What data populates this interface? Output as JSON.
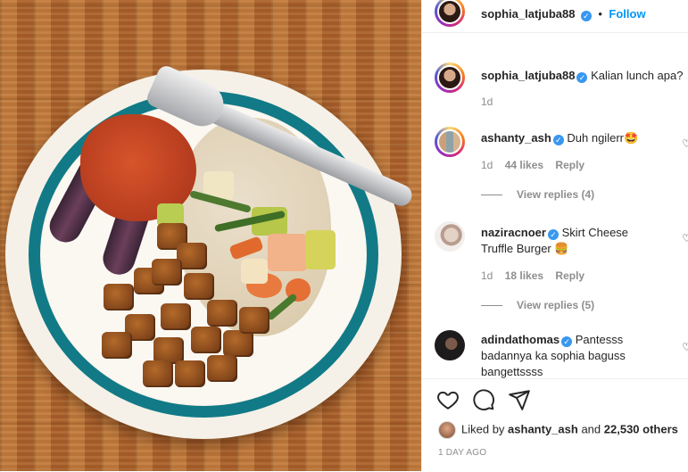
{
  "post": {
    "author": "sophia_latjuba88",
    "follow_label": "Follow",
    "dot": "•",
    "caption": "Kalian lunch apa?",
    "caption_time": "1d"
  },
  "comments": [
    {
      "user": "ashanty_ash",
      "text": "Duh ngilerr🤩",
      "time": "1d",
      "likes": "44 likes",
      "reply_label": "Reply",
      "view_replies": "View replies (4)"
    },
    {
      "user": "naziracnoer",
      "text": "Skirt Cheese Truffle Burger 🍔",
      "time": "1d",
      "likes": "18 likes",
      "reply_label": "Reply",
      "view_replies": "View replies (5)"
    },
    {
      "user": "adindathomas",
      "text": "Pantesss badannya ka sophia baguss bangettssss"
    }
  ],
  "footer": {
    "liked_by_prefix": "Liked by",
    "liked_by_user": "ashanty_ash",
    "and": "and",
    "others": "22,530 others",
    "time_ago": "1 DAY AGO"
  },
  "icons": {
    "like": "heart-icon",
    "comment": "comment-icon",
    "share": "share-icon",
    "verified": "verified-badge-icon"
  },
  "colors": {
    "accent": "#0095f6",
    "verified": "#3897f0",
    "muted": "#8e8e8e",
    "plate_rim": "#117a86"
  }
}
